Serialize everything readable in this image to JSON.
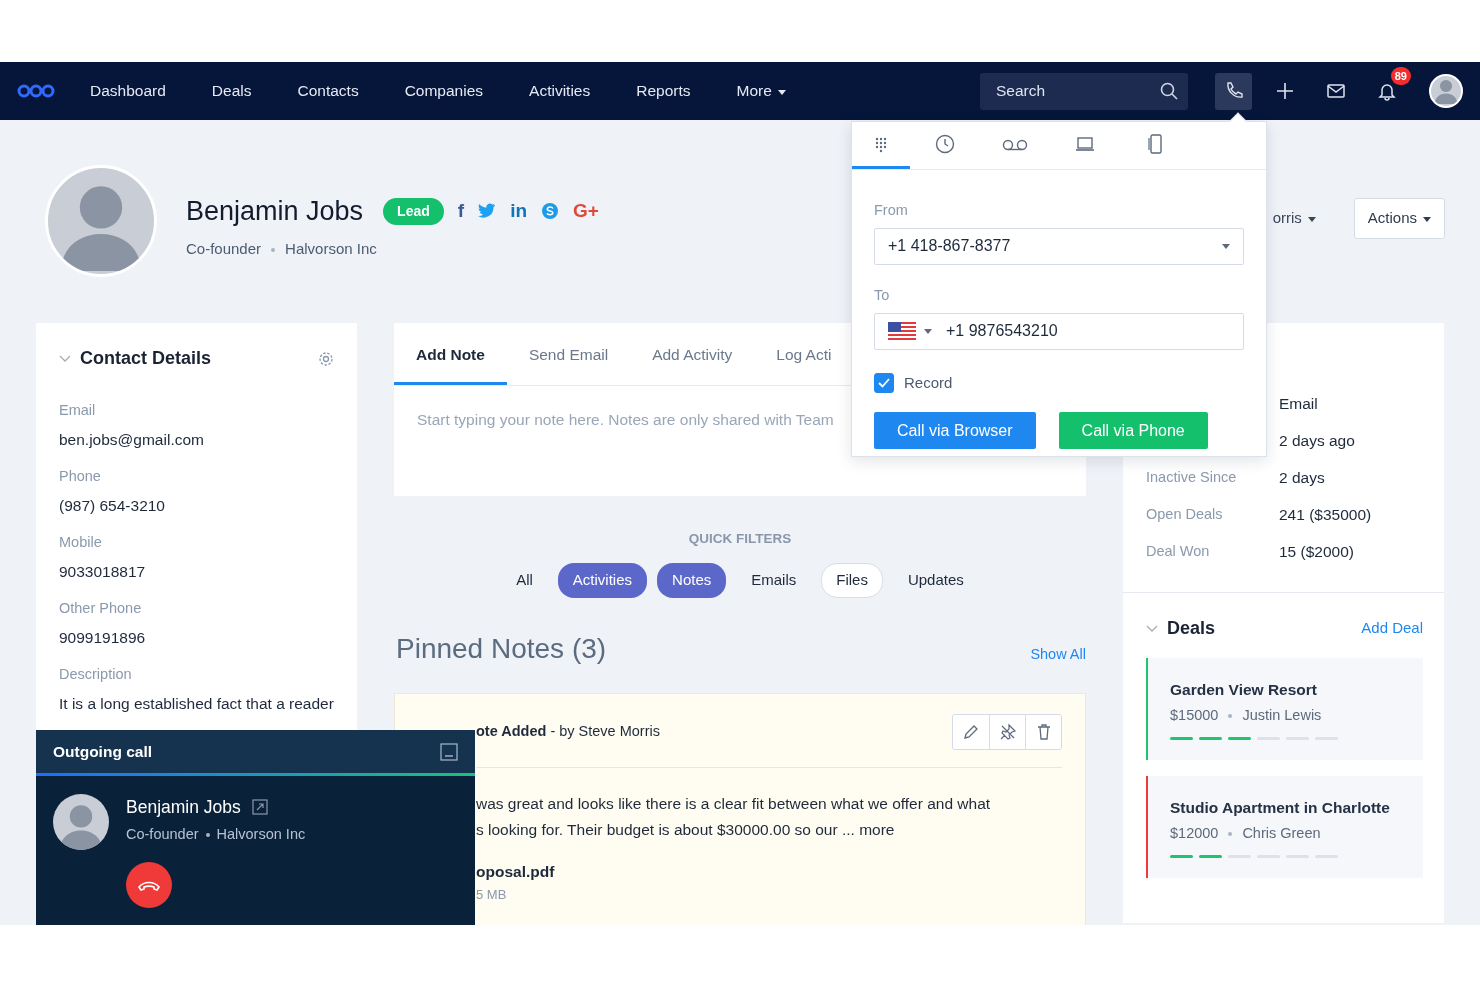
{
  "navbar": {
    "items": [
      {
        "label": "Dashboard",
        "caret": false
      },
      {
        "label": "Deals",
        "caret": false
      },
      {
        "label": "Contacts",
        "caret": false
      },
      {
        "label": "Companies",
        "caret": false
      },
      {
        "label": "Activities",
        "caret": false
      },
      {
        "label": "Reports",
        "caret": false
      },
      {
        "label": "More",
        "caret": true
      }
    ],
    "search": {
      "placeholder": "Search"
    },
    "actions": [
      {
        "kind": "phone",
        "selected": true
      },
      {
        "kind": "plus",
        "selected": false
      },
      {
        "kind": "mail",
        "selected": false
      },
      {
        "kind": "bell",
        "selected": false,
        "badge": "89"
      }
    ]
  },
  "contact": {
    "name": "Benjamin Jobs",
    "tag": "Lead",
    "role": "Co-founder",
    "company": "Halvorson Inc",
    "social": [
      {
        "kind": "facebook",
        "text": "f"
      },
      {
        "kind": "twitter"
      },
      {
        "kind": "linkedin",
        "text": "in"
      },
      {
        "kind": "skype"
      },
      {
        "kind": "google",
        "text": "G+"
      }
    ]
  },
  "header_actions": {
    "owner": "orris",
    "actions": "Actions"
  },
  "contact_details": {
    "title": "Contact Details",
    "fields": [
      {
        "label": "Email",
        "value": "ben.jobs@gmail.com"
      },
      {
        "label": "Phone",
        "value": "(987) 654-3210"
      },
      {
        "label": "Mobile",
        "value": "9033018817"
      },
      {
        "label": "Other Phone",
        "value": "9099191896"
      },
      {
        "label": "Description",
        "value": "It is a long established fact that a reader"
      }
    ]
  },
  "composer": {
    "tabs": [
      {
        "label": "Add Note",
        "selected": true
      },
      {
        "label": "Send Email",
        "selected": false
      },
      {
        "label": "Add Activity",
        "selected": false
      },
      {
        "label": "Log Acti",
        "selected": false
      }
    ],
    "placeholder": "Start typing your note here. Notes are only shared with Team"
  },
  "quick_filters": {
    "title": "QUICK FILTERS",
    "items": [
      {
        "label": "All",
        "selected": false,
        "bordered": false
      },
      {
        "label": "Activities",
        "selected": true,
        "bordered": false
      },
      {
        "label": "Notes",
        "selected": true,
        "bordered": false
      },
      {
        "label": "Emails",
        "selected": false,
        "bordered": false
      },
      {
        "label": "Files",
        "selected": false,
        "bordered": true
      },
      {
        "label": "Updates",
        "selected": false,
        "bordered": false
      }
    ]
  },
  "pinned_notes": {
    "title": "Pinned Notes (3)",
    "show_all": "Show All",
    "note": {
      "header": "**ote Added** - by Steve Morris",
      "lines": [
        "was great and looks like there is a clear fit between what we offer and what",
        "s looking for. Their budget is about $30000.00 so our ... more"
      ],
      "file": "oposal.pdf",
      "size": "5 MB"
    }
  },
  "summary": {
    "rows": [
      {
        "value": "Email"
      },
      {
        "value": "2 days ago"
      },
      {
        "label": "Inactive Since",
        "value": "2 days"
      },
      {
        "label": "Open Deals",
        "value": "241 ($35000)"
      },
      {
        "label": "Deal Won",
        "value": "15 ($2000)"
      }
    ]
  },
  "deals": {
    "title": "Deals",
    "add": "Add Deal",
    "items": [
      {
        "title": "Garden View Resort",
        "amount": "$15000",
        "owner": "Justin Lewis",
        "color": "#1fc46e",
        "level": 0.5
      },
      {
        "title": "Studio Apartment in Charlotte",
        "amount": "$12000",
        "owner": "Chris Green",
        "color": "#f03a3a",
        "level": 0.3333
      }
    ]
  },
  "dialer": {
    "tabs": [
      {
        "kind": "keypad",
        "selected": true
      },
      {
        "kind": "clock",
        "selected": false
      },
      {
        "kind": "voicemail",
        "selected": false
      },
      {
        "kind": "laptop",
        "selected": false
      },
      {
        "kind": "mobile",
        "selected": false
      }
    ],
    "from_label": "From",
    "from_value": "+1 418-867-8377",
    "to_label": "To",
    "to_value": "+1 9876543210",
    "record": {
      "label": "Record",
      "checked": true
    },
    "browser_button": "Call via Browser",
    "phone_button": "Call via Phone"
  },
  "outgoing_call": {
    "title": "Outgoing call",
    "name": "Benjamin Jobs",
    "role": "Co-founder",
    "company": "Halvorson Inc"
  }
}
